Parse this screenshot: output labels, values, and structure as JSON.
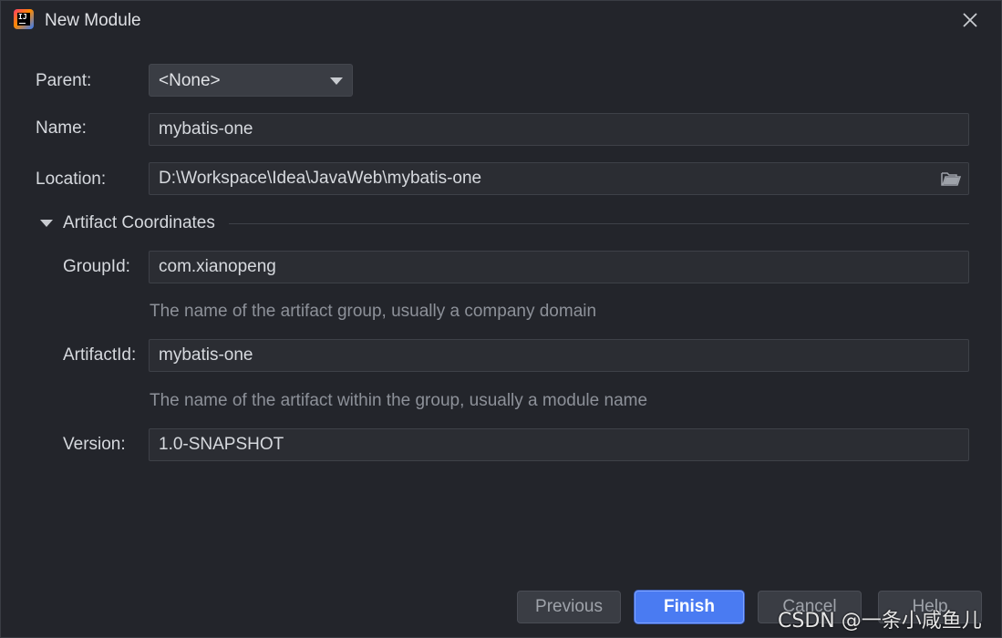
{
  "window": {
    "title": "New Module",
    "app_icon": "intellij-idea-icon",
    "close_icon": "close-icon"
  },
  "form": {
    "parent": {
      "label": "Parent:",
      "value": "<None>"
    },
    "name": {
      "label": "Name:",
      "value": "mybatis-one"
    },
    "location": {
      "label": "Location:",
      "value": "D:\\Workspace\\Idea\\JavaWeb\\mybatis-one",
      "icon": "folder-open-icon"
    }
  },
  "artifact": {
    "section_title": "Artifact Coordinates",
    "group_id": {
      "label": "GroupId:",
      "value": "com.xianopeng",
      "hint": "The name of the artifact group, usually a company domain"
    },
    "artifact_id": {
      "label": "ArtifactId:",
      "value": "mybatis-one",
      "hint": "The name of the artifact within the group, usually a module name"
    },
    "version": {
      "label": "Version:",
      "value": "1.0-SNAPSHOT"
    }
  },
  "buttons": {
    "previous": "Previous",
    "finish": "Finish",
    "cancel": "Cancel",
    "help": "Help"
  },
  "watermark": "CSDN @一条小咸鱼儿",
  "colors": {
    "background": "#23252b",
    "field_bg": "#2b2d33",
    "accent": "#4a7bf2",
    "hint_text": "#8d9199"
  }
}
